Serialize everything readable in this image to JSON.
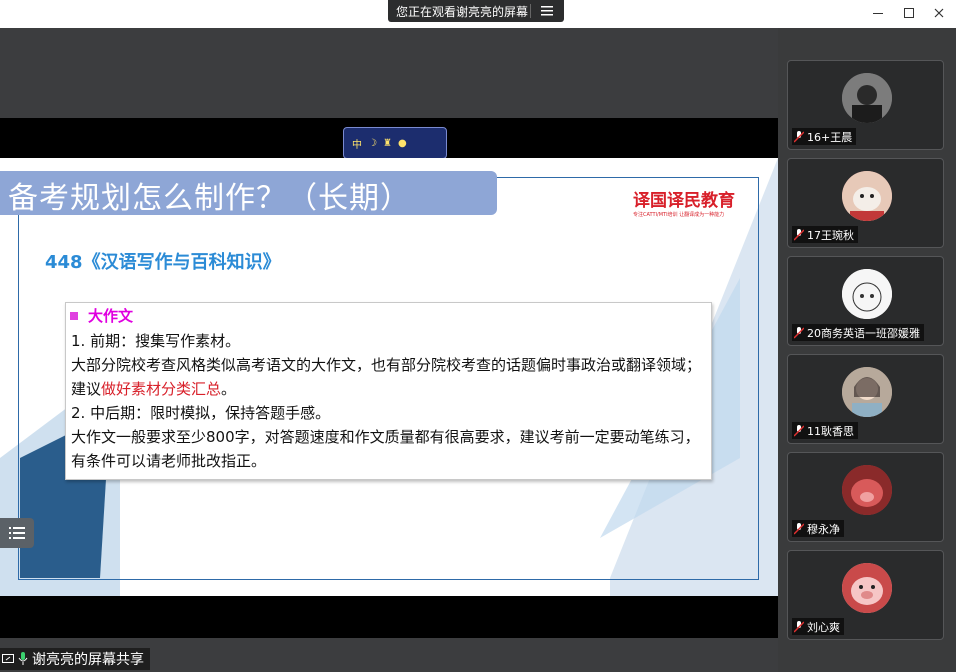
{
  "share_banner": {
    "text": "您正在观看谢亮亮的屏幕",
    "menu_icon": "list-icon"
  },
  "window_controls": {
    "minimize_icon": "minimize-icon",
    "maximize_icon": "maximize-icon",
    "close_icon": "close-icon"
  },
  "slide": {
    "title": "备考规划怎么制作？（长期）",
    "logo_main": "译国译民教育",
    "logo_sub": "专注CATTI/MTI培训 让翻译成为一种能力",
    "subject": "448《汉语写作与百科知识》",
    "section_title": "大作文",
    "item1_title": "1.   前期：搜集写作素材。",
    "item1_body_a": "    大部分院校考查风格类似高考语文的大作文，也有部分院校考查的话题偏时事政治或翻译领域；建议",
    "item1_body_highlight": "做好素材分类汇总",
    "item1_body_end": "。",
    "item2_title": "2.   中后期：限时模拟，保持答题手感。",
    "item2_body": "    大作文一般要求至少800字，对答题速度和作文质量都有很高要求，建议考前一定要动笔练习，有条件可以请老师批改指正。"
  },
  "screen_share_label": "谢亮亮的屏幕共享",
  "participants": [
    {
      "name": "16+王晨"
    },
    {
      "name": "17王琬秋"
    },
    {
      "name": "20商务英语一班邵媛雅"
    },
    {
      "name": "11耿香思"
    },
    {
      "name": "穆永净"
    },
    {
      "name": "刘心爽"
    }
  ],
  "colors": {
    "accent": "#8ea6d6",
    "highlight": "#d8202a",
    "section": "#e000e0",
    "subject": "#2b8bd6"
  }
}
